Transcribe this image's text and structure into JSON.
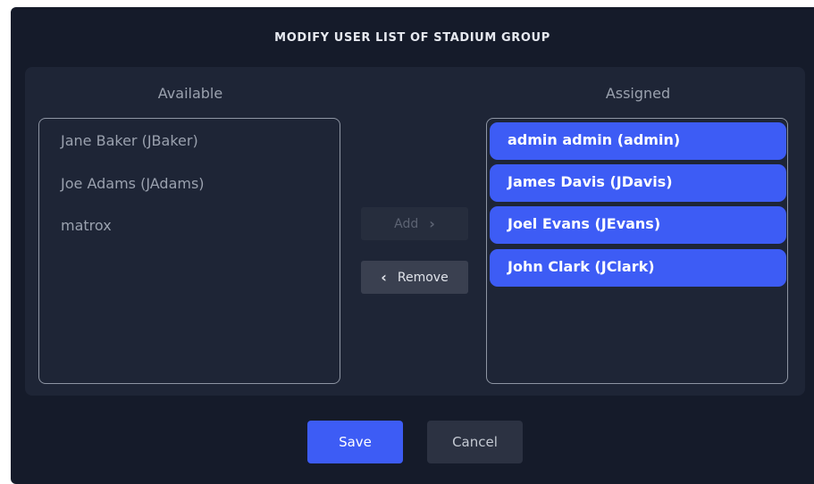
{
  "dialog": {
    "title": "MODIFY USER LIST OF STADIUM GROUP"
  },
  "available": {
    "label": "Available",
    "items": [
      {
        "label": "Jane Baker (JBaker)"
      },
      {
        "label": "Joe Adams (JAdams)"
      },
      {
        "label": "matrox"
      }
    ]
  },
  "assigned": {
    "label": "Assigned",
    "items": [
      {
        "label": "admin admin (admin)"
      },
      {
        "label": "James Davis (JDavis)"
      },
      {
        "label": "Joel Evans (JEvans)"
      },
      {
        "label": "John Clark (JClark)"
      }
    ]
  },
  "actions": {
    "add_label": "Add",
    "remove_label": "Remove",
    "add_icon": "chevron-right-icon",
    "remove_icon": "chevron-left-icon"
  },
  "footer": {
    "save_label": "Save",
    "cancel_label": "Cancel"
  },
  "colors": {
    "accent": "#3d5cf5",
    "dialog_bg": "#151b2a",
    "panel_bg": "#1e2536"
  }
}
